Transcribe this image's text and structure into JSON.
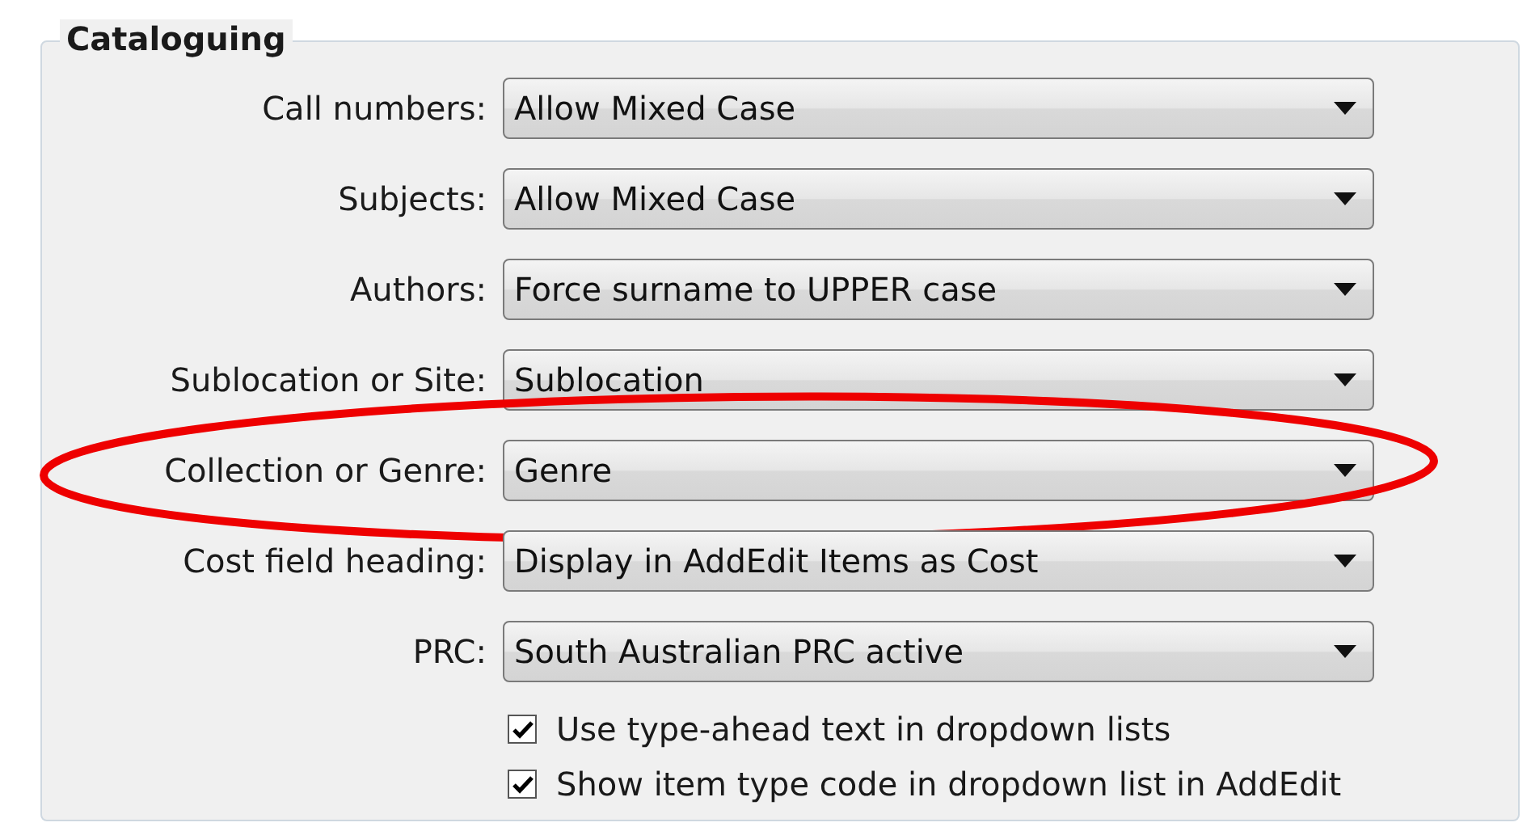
{
  "group": {
    "title": "Cataloguing"
  },
  "rows": [
    {
      "label": "Call numbers:",
      "value": "Allow Mixed Case",
      "highlighted": false
    },
    {
      "label": "Subjects:",
      "value": "Allow Mixed Case",
      "highlighted": false
    },
    {
      "label": "Authors:",
      "value": "Force surname to UPPER case",
      "highlighted": false
    },
    {
      "label": "Sublocation or Site:",
      "value": "Sublocation",
      "highlighted": false
    },
    {
      "label": "Collection or Genre:",
      "value": "Genre",
      "highlighted": true
    },
    {
      "label": "Cost field heading:",
      "value": "Display in AddEdit Items as Cost",
      "highlighted": false
    },
    {
      "label": "PRC:",
      "value": "South Australian PRC active",
      "highlighted": false
    }
  ],
  "options": [
    {
      "label": "Use type-ahead text in dropdown lists",
      "checked": true
    },
    {
      "label": "Show item type code in dropdown list in AddEdit",
      "checked": true
    }
  ]
}
